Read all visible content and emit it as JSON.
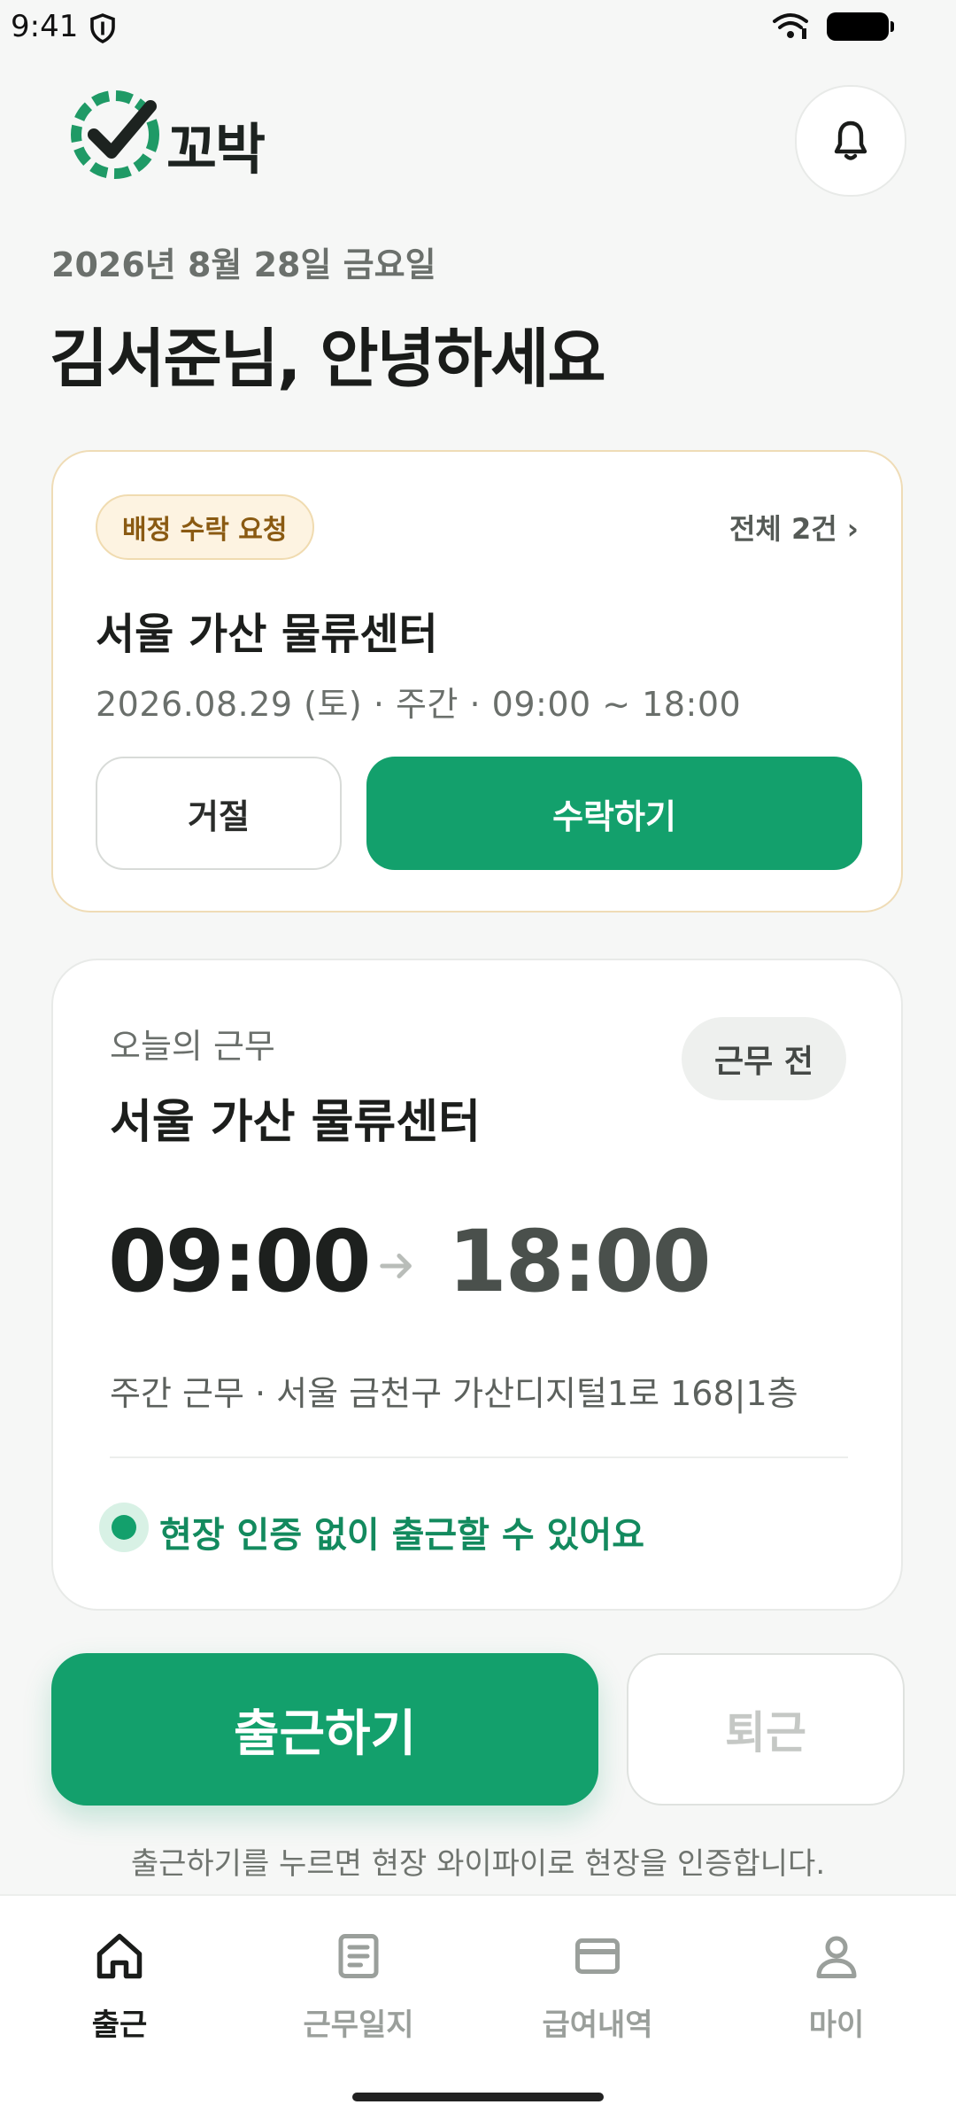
{
  "status_bar": {
    "time": "9:41"
  },
  "header": {
    "logo_text": "꼬박"
  },
  "date_text": "2026년 8월 28일 금요일",
  "greeting": "김서준님, 안녕하세요",
  "assignment": {
    "badge": "배정 수락 요청",
    "view_all": "전체 2건 ›",
    "place": "서울 가산 물류센터",
    "meta": "2026.08.29 (토)  ·  주간  ·  09:00 ~ 18:00",
    "reject_label": "거절",
    "accept_label": "수락하기"
  },
  "today": {
    "label": "오늘의 근무",
    "place": "서울 가산 물류센터",
    "status": "근무 전",
    "start": "09:00",
    "end": "18:00",
    "detail": "주간 근무 · 서울 금천구 가산디지털1로 168|1층",
    "verify_text": "현장 인증 없이 출근할 수 있어요"
  },
  "actions": {
    "checkin_label": "출근하기",
    "checkout_label": "퇴근",
    "hint": "출근하기를 누르면 현장 와이파이로 현장을 인증합니다."
  },
  "nav": {
    "items": [
      {
        "label": "출근",
        "icon": "home-icon",
        "active": true
      },
      {
        "label": "근무일지",
        "icon": "document-icon",
        "active": false
      },
      {
        "label": "급여내역",
        "icon": "card-icon",
        "active": false
      },
      {
        "label": "마이",
        "icon": "person-icon",
        "active": false
      }
    ]
  },
  "colors": {
    "primary": "#13a06c",
    "badge_bg": "#fdf3e1",
    "badge_text": "#8a5a12"
  }
}
